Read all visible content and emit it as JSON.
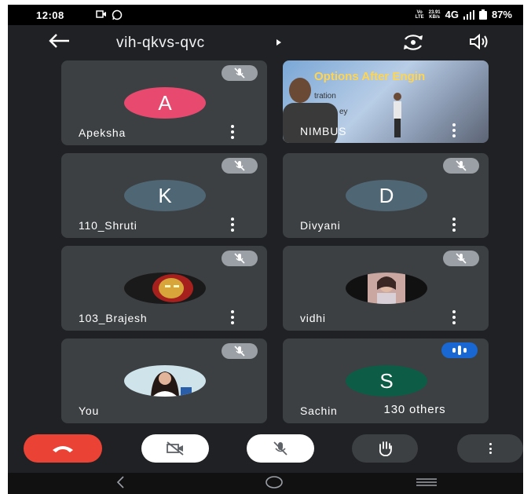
{
  "status_bar": {
    "time": "12:08",
    "volte_top": "Vo",
    "volte_bottom": "LTE",
    "speed_top": "23.91",
    "speed_bottom": "KB/s",
    "network": "4G",
    "battery": "87%"
  },
  "header": {
    "meeting_code": "vih-qkvs-qvc"
  },
  "participants": [
    {
      "name": "Apeksha",
      "avatar_letter": "A",
      "avatar_color": "#e84a6f",
      "muted": true
    },
    {
      "name": "NIMBUS",
      "video": true,
      "video_banner": "Options After Engin",
      "video_text_1": "tration",
      "video_text_2": "ey"
    },
    {
      "name": "110_Shruti",
      "avatar_letter": "K",
      "avatar_color": "#4f6775",
      "muted": true
    },
    {
      "name": "Divyani",
      "avatar_letter": "D",
      "avatar_color": "#4f6775",
      "muted": true
    },
    {
      "name": "103_Brajesh",
      "avatar_photo": "ironman",
      "muted": true
    },
    {
      "name": "vidhi",
      "avatar_photo": "person",
      "muted": true
    },
    {
      "name": "You",
      "avatar_photo": "selfie",
      "muted": true
    },
    {
      "name": "Sachin",
      "avatar_letter": "S",
      "avatar_color": "#0d5c46",
      "speaking": true
    }
  ],
  "others_chip": "130 others",
  "controls": {
    "end_call_color": "#ea4335",
    "camera_off_bg": "#ffffff",
    "mic_off_bg": "#ffffff",
    "raise_hand_bg": "#3c4043",
    "more_bg": "#3c4043"
  },
  "icons": [
    "back-arrow-icon",
    "flip-camera-icon",
    "speaker-icon",
    "mic-off-icon",
    "more-vert-icon",
    "end-call-icon",
    "camera-off-icon",
    "raise-hand-icon",
    "nav-back-icon",
    "nav-home-icon",
    "nav-recents-icon"
  ]
}
